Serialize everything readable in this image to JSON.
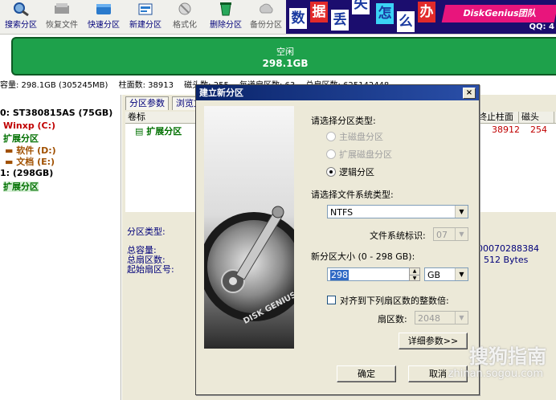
{
  "toolbar": {
    "items": [
      {
        "label": "搜索分区",
        "icon": "search-partition-icon",
        "enabled": true
      },
      {
        "label": "恢复文件",
        "icon": "recover-file-icon",
        "enabled": false
      },
      {
        "label": "快速分区",
        "icon": "quick-partition-icon",
        "enabled": true
      },
      {
        "label": "新建分区",
        "icon": "new-partition-icon",
        "enabled": true
      },
      {
        "label": "格式化",
        "icon": "format-icon",
        "enabled": false
      },
      {
        "label": "删除分区",
        "icon": "delete-partition-icon",
        "enabled": true
      },
      {
        "label": "备份分区",
        "icon": "backup-partition-icon",
        "enabled": false
      }
    ]
  },
  "banner": {
    "tiles": [
      "数",
      "据",
      "丢",
      "失",
      "怎",
      "么",
      "办"
    ],
    "brand": "DiskGenius团队",
    "qq": "QQ: 4"
  },
  "diskbar": {
    "label": "空闲",
    "size": "298.1GB"
  },
  "infoline": {
    "capacity": "容量: 298.1GB (305245MB)",
    "cylinders": "柱面数: 38913",
    "heads": "磁头数: 255",
    "sectors": "每道扇区数: 63",
    "total_sectors": "总扇区数: 625142448"
  },
  "tree": {
    "nodes": [
      {
        "text": "0: ST380815AS (75GB)",
        "color": "#000000"
      },
      {
        "text": "Winxp (C:)",
        "color": "#c00000"
      },
      {
        "text": "扩展分区",
        "color": "#007000"
      },
      {
        "text": "软件 (D:)",
        "color": "#a05000"
      },
      {
        "text": "文档 (E:)",
        "color": "#a05000"
      },
      {
        "text": "1: (298GB)",
        "color": "#000000"
      },
      {
        "text": "扩展分区",
        "color": "#007000"
      }
    ]
  },
  "rightpanel": {
    "tabs": [
      "分区参数",
      "浏览文件"
    ],
    "columns": {
      "volume": "卷标",
      "end_cyl": "终止柱面",
      "head": "磁头"
    },
    "row": {
      "name": "扩展分区",
      "end_cyl": "38912",
      "head": "254"
    },
    "details": {
      "type_label": "分区类型:",
      "total_capacity": "总容量:",
      "total_sectors": "总扇区数:",
      "start_sector": "起始扇区号:",
      "guid_tail": "00070288384",
      "sector_size": "512 Bytes"
    }
  },
  "dialog": {
    "title": "建立新分区",
    "close": "×",
    "type_prompt": "请选择分区类型:",
    "types": [
      {
        "label": "主磁盘分区",
        "selected": false,
        "enabled": false
      },
      {
        "label": "扩展磁盘分区",
        "selected": false,
        "enabled": false
      },
      {
        "label": "逻辑分区",
        "selected": true,
        "enabled": true
      }
    ],
    "fs_prompt": "请选择文件系统类型:",
    "fs_value": "NTFS",
    "fs_id_label": "文件系统标识:",
    "fs_id_value": "07",
    "size_label": "新分区大小 (0 - 298 GB):",
    "size_value": "298",
    "size_unit": "GB",
    "align_label": "对齐到下列扇区数的整数倍:",
    "sector_count_label": "扇区数:",
    "sector_count_value": "2048",
    "detail_button": "详细参数>>",
    "ok_button": "确定",
    "cancel_button": "取消",
    "image_text": "DISK GENIUS"
  },
  "watermark": {
    "line1": "搜狗指南",
    "line2": "zhinan.sogou.com"
  }
}
